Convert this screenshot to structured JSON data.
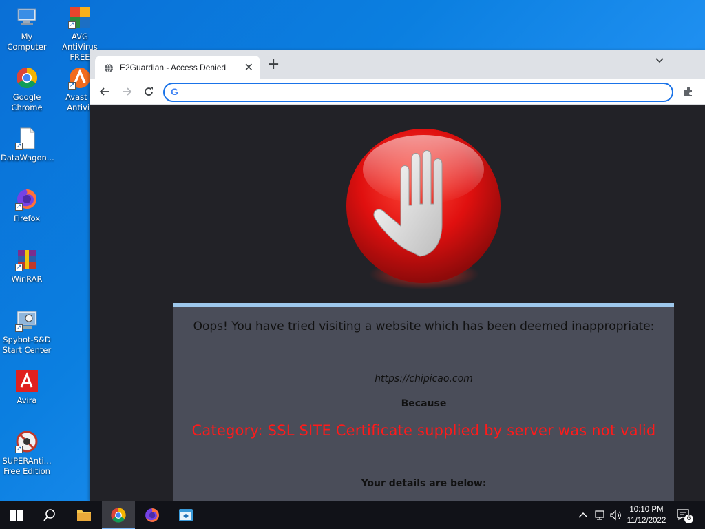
{
  "desktop": {
    "icons": [
      {
        "label": "My Computer",
        "icon": "computer-icon"
      },
      {
        "label": "AVG AntiVirus FREE",
        "icon": "avg-icon"
      },
      {
        "label": "Google Chrome",
        "icon": "chrome-icon"
      },
      {
        "label": "Avast F Antivir",
        "icon": "avast-icon"
      },
      {
        "label": "DataWagon...",
        "icon": "file-icon"
      },
      {
        "label": "Firefox",
        "icon": "firefox-icon"
      },
      {
        "label": "WinRAR",
        "icon": "winrar-icon"
      },
      {
        "label": "Spybot-S&D Start Center",
        "icon": "spybot-icon"
      },
      {
        "label": "Avira",
        "icon": "avira-icon"
      },
      {
        "label": "SUPERAnti... Free Edition",
        "icon": "superantispyware-icon"
      }
    ]
  },
  "browser": {
    "tab_title": "E2Guardian - Access Denied",
    "address_value": "",
    "address_placeholder": ""
  },
  "page": {
    "headline": "Oops! You have tried visiting a website which has been deemed inappropriate:",
    "url": "https://chipicao.com",
    "because": "Because",
    "category": "Category: SSL SITE  Certificate supplied by server was not valid",
    "details": "Your details are below:"
  },
  "taskbar": {
    "time": "10:10 PM",
    "date": "11/12/2022",
    "notification_count": "6"
  },
  "colors": {
    "accent": "#1a73e8",
    "category_text": "#ff1a1a",
    "card_bg": "#4a4d59",
    "page_bg": "#222227"
  }
}
